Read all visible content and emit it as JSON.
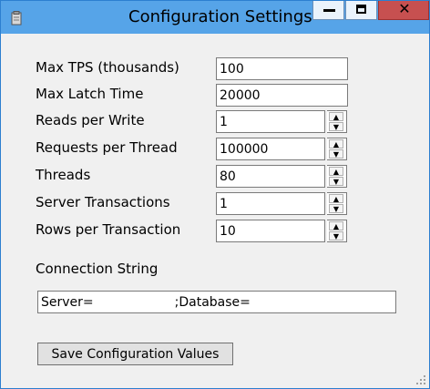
{
  "window": {
    "title": "Configuration Settings",
    "close_glyph": "✕",
    "icons": {
      "app": "app-icon",
      "minimize": "minimize-icon",
      "maximize": "maximize-icon",
      "close": "close-icon"
    }
  },
  "fields": [
    {
      "label": "Max TPS (thousands)",
      "value": "100",
      "type": "text"
    },
    {
      "label": "Max Latch Time",
      "value": "20000",
      "type": "text"
    },
    {
      "label": "Reads per Write",
      "value": "1",
      "type": "numeric"
    },
    {
      "label": "Requests per Thread",
      "value": "100000",
      "type": "numeric"
    },
    {
      "label": "Threads",
      "value": "80",
      "type": "numeric"
    },
    {
      "label": "Server Transactions",
      "value": "1",
      "type": "numeric"
    },
    {
      "label": "Rows per Transaction",
      "value": "10",
      "type": "numeric"
    }
  ],
  "connection": {
    "label": "Connection String",
    "value": "Server=                    ;Database="
  },
  "actions": {
    "save_label": "Save Configuration Values"
  },
  "colors": {
    "titlebar": "#56a4e8",
    "close_button": "#c75050",
    "window_bg": "#f0f0f0"
  }
}
